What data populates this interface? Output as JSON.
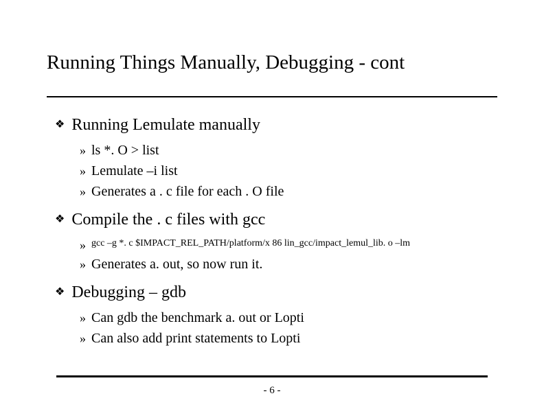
{
  "title": "Running Things Manually, Debugging - cont",
  "sections": [
    {
      "heading": "Running Lemulate manually",
      "items": [
        {
          "text": "ls *. O > list",
          "small": false
        },
        {
          "text": "Lemulate –i list",
          "small": false
        },
        {
          "text": "Generates a . c file for each . O file",
          "small": false
        }
      ]
    },
    {
      "heading": "Compile the . c files with gcc",
      "items": [
        {
          "text": "gcc –g *. c $IMPACT_REL_PATH/platform/x 86 lin_gcc/impact_lemul_lib. o –lm",
          "small": true
        },
        {
          "text": "Generates a. out, so now run it.",
          "small": false
        }
      ]
    },
    {
      "heading": "Debugging – gdb",
      "items": [
        {
          "text": "Can gdb the benchmark a. out or Lopti",
          "small": false
        },
        {
          "text": "Can also add print statements to Lopti",
          "small": false
        }
      ]
    }
  ],
  "page": "- 6 -",
  "bullets": {
    "diamond": "❖",
    "arrow": "»"
  }
}
